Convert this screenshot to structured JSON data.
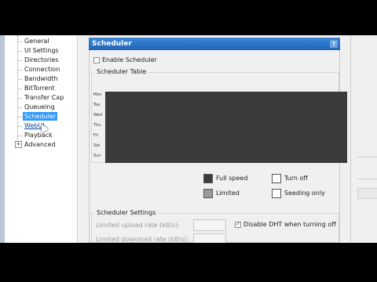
{
  "tree": {
    "items": [
      {
        "label": "General"
      },
      {
        "label": "UI Settings"
      },
      {
        "label": "Directories"
      },
      {
        "label": "Connection"
      },
      {
        "label": "Bandwidth"
      },
      {
        "label": "BitTorrent"
      },
      {
        "label": "Transfer Cap"
      },
      {
        "label": "Queueing"
      },
      {
        "label": "Scheduler",
        "selected": true
      },
      {
        "label": "WebUI"
      },
      {
        "label": "Playback"
      },
      {
        "label": "Advanced"
      }
    ],
    "advanced_expander": "+"
  },
  "panel": {
    "title": "Scheduler",
    "help_label": "?",
    "enable_scheduler_label": "Enable Scheduler",
    "scheduler_table_title": "Scheduler Table",
    "days": [
      "Mon",
      "Tue",
      "Wed",
      "Thu",
      "Fri",
      "Sat",
      "Sun"
    ],
    "hours_per_day": 24,
    "legend": {
      "full_speed": "Full speed",
      "turn_off": "Turn off",
      "limited": "Limited",
      "seeding_only": "Seeding only"
    },
    "settings_title": "Scheduler Settings",
    "limited_upload_label": "Limited upload rate (kB/s):",
    "limited_download_label": "Limited download rate (kB/s):",
    "disable_dht_label": "Disable DHT when turning off",
    "disable_dht_checked": true,
    "enable_scheduler_checked": false
  },
  "colors": {
    "header": "#1f63b6",
    "selected": "#3399ff",
    "full_speed": "#3b3b3b",
    "turn_off": "#ffffff",
    "limited": "#9a9a9a",
    "seeding_only": "#ffffff"
  }
}
